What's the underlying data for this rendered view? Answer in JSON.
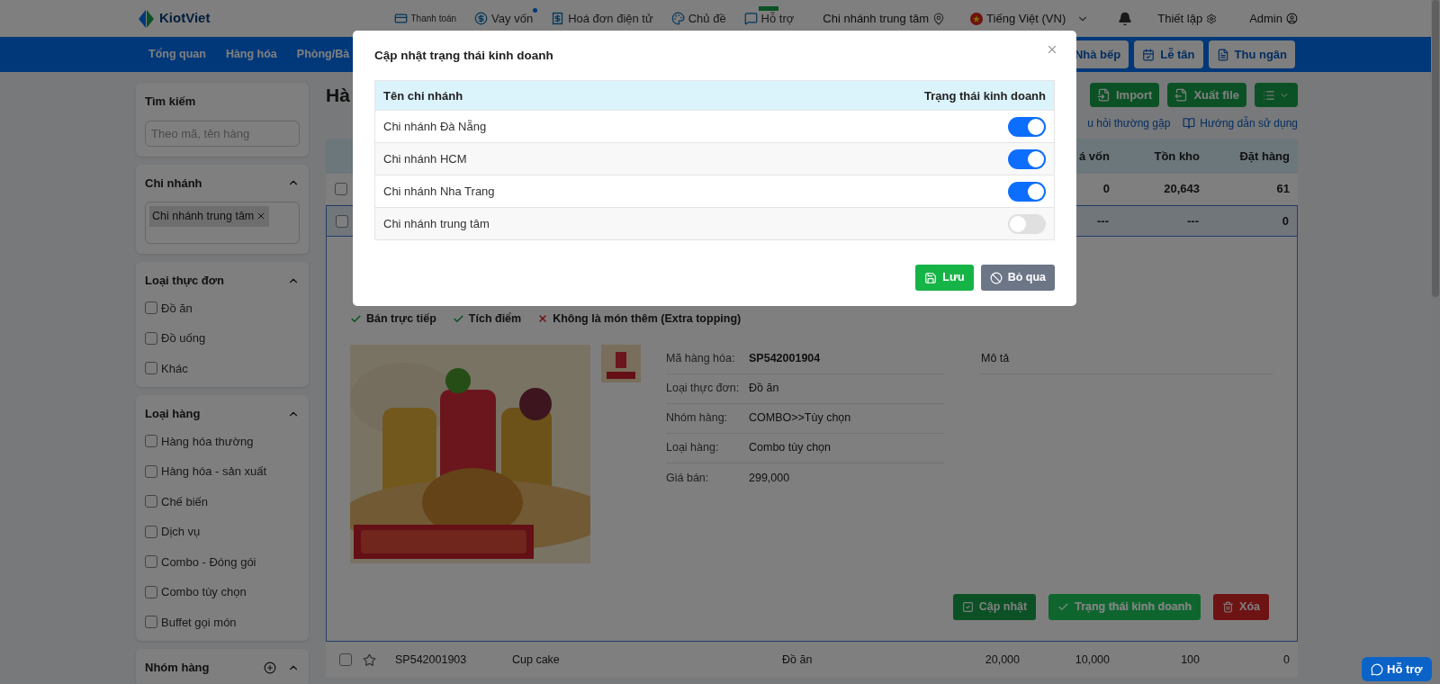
{
  "topbar": {
    "logo": "KiotViet",
    "links": [
      {
        "kind": "payment",
        "label": "Thanh toán",
        "dot": false,
        "badge": false
      },
      {
        "kind": "loan",
        "label": "Vay vốn",
        "dot": true,
        "badge": false
      },
      {
        "kind": "invoice",
        "label": "Hoá đơn điện tử",
        "dot": false,
        "badge": false
      },
      {
        "kind": "theme",
        "label": "Chủ đề",
        "dot": false,
        "badge": false
      },
      {
        "kind": "support",
        "label": "Hỗ trợ",
        "dot": false,
        "badge": true
      }
    ],
    "branch": "Chi nhánh trung tâm",
    "language": "Tiếng Việt (VN)",
    "settings": "Thiết lập",
    "user": "Admin"
  },
  "nav": {
    "items": [
      "Tổng quan",
      "Hàng hóa",
      "Phòng/Bà"
    ],
    "buttons": [
      {
        "kind": "kitchen",
        "label": "Nhà bếp"
      },
      {
        "kind": "reception",
        "label": "Lễ tân"
      },
      {
        "kind": "cashier",
        "label": "Thu ngân"
      }
    ]
  },
  "sidebar": {
    "search": {
      "title": "Tìm kiếm",
      "placeholder": "Theo mã, tên hàng"
    },
    "branch": {
      "title": "Chi nhánh",
      "tags": [
        "Chi nhánh trung tâm"
      ]
    },
    "groups": [
      {
        "title": "Loại thực đơn",
        "options": [
          {
            "label": "Đồ ăn",
            "checked": false
          },
          {
            "label": "Đồ uống",
            "checked": false
          },
          {
            "label": "Khác",
            "checked": false
          }
        ]
      },
      {
        "title": "Loại hàng",
        "options": [
          {
            "label": "Hàng hóa thường",
            "checked": false
          },
          {
            "label": "Hàng hóa - sản xuất",
            "checked": false
          },
          {
            "label": "Chế biến",
            "checked": false
          },
          {
            "label": "Dịch vụ",
            "checked": false
          },
          {
            "label": "Combo - Đóng gói",
            "checked": false
          },
          {
            "label": "Combo tùy chọn",
            "checked": false
          },
          {
            "label": "Buffet gọi món",
            "checked": false
          }
        ]
      }
    ],
    "last_section": "Nhóm hàng"
  },
  "main": {
    "title": "Hà",
    "actions": [
      {
        "kind": "import",
        "label": "Import"
      },
      {
        "kind": "export",
        "label": "Xuất file"
      },
      {
        "kind": "menu"
      }
    ],
    "help_links": [
      {
        "kind": "faq",
        "label": "u hỏi thường gặp"
      },
      {
        "kind": "guide",
        "label": "Hướng dẫn sử dụng"
      }
    ],
    "table": {
      "columns": [
        "á vốn",
        "Tồn kho",
        "Đặt hàng"
      ],
      "rows": [
        {
          "selected": false,
          "checked": false,
          "cells": [
            "0",
            "20,643",
            "61"
          ]
        },
        {
          "selected": true,
          "checked": false,
          "cells": [
            "---",
            "---",
            "0"
          ]
        }
      ],
      "detail": {
        "flags": [
          {
            "label": "Bán trực tiếp",
            "on": true
          },
          {
            "label": "Tích điểm",
            "on": true
          },
          {
            "label": "Không là món thêm (Extra topping)",
            "on": false
          }
        ],
        "fields": [
          {
            "label": "Mã hàng hóa:",
            "value": "SP542001904",
            "strong": true
          },
          {
            "label": "Loại thực đơn:",
            "value": "Đồ ăn",
            "strong": false
          },
          {
            "label": "Nhóm hàng:",
            "value": "COMBO>>Tùy chọn",
            "strong": false
          },
          {
            "label": "Loại hàng:",
            "value": "Combo tùy chọn",
            "strong": false
          },
          {
            "label": "Giá bán:",
            "value": "299,000",
            "strong": false
          }
        ],
        "description_label": "Mô tả",
        "buttons": [
          {
            "kind": "update",
            "label": "Cập nhật",
            "selected": false
          },
          {
            "kind": "status",
            "label": "Trạng thái kinh doanh",
            "selected": true
          },
          {
            "kind": "delete",
            "label": "Xóa",
            "selected": false
          }
        ]
      },
      "next_row": {
        "selected": false,
        "checked": false,
        "code": "SP542001903",
        "name": "Cup cake",
        "menu_type": "Đồ ăn",
        "price": "20,000",
        "cost": "10,000",
        "stock": "100",
        "ordered": "0"
      }
    }
  },
  "modal": {
    "title": "Cập nhật trạng thái kinh doanh",
    "columns": [
      "Tên chi nhánh",
      "Trạng thái kinh doanh"
    ],
    "rows": [
      {
        "name": "Chi nhánh Đà Nẵng",
        "on": true
      },
      {
        "name": "Chi nhánh HCM",
        "on": true
      },
      {
        "name": "Chi nhánh Nha Trang",
        "on": true
      },
      {
        "name": "Chi nhánh trung tâm",
        "on": false
      }
    ],
    "buttons": [
      {
        "kind": "save",
        "label": "Lưu"
      },
      {
        "kind": "cancel",
        "label": "Bỏ qua"
      }
    ]
  },
  "chat_button": "Hỗ trợ"
}
